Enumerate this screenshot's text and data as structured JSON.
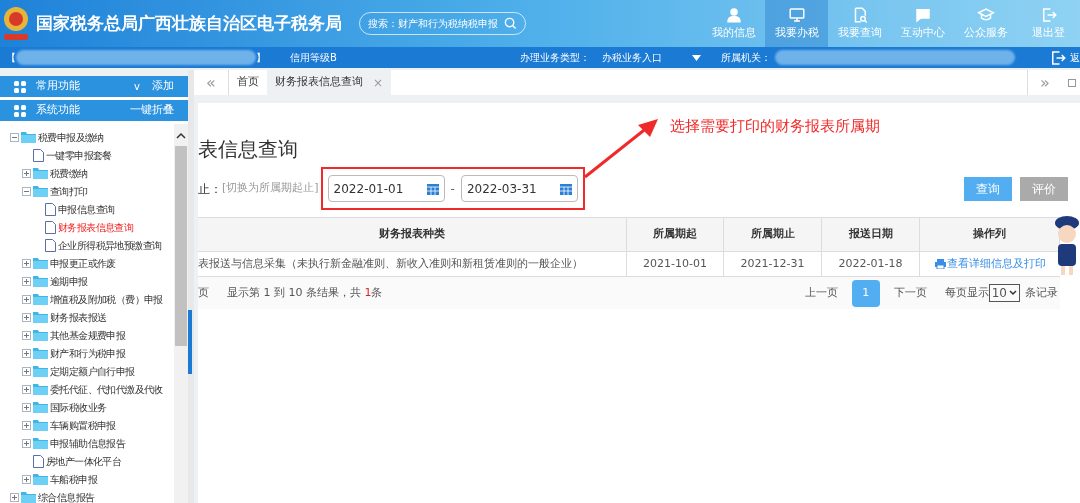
{
  "header": {
    "title": "国家税务总局广西壮族自治区电子税务局",
    "search": {
      "placeholder": "搜索：财产和行为税纳税申报"
    },
    "nav": [
      {
        "label": "我的信息",
        "selected": false
      },
      {
        "label": "我要办税",
        "selected": true
      },
      {
        "label": "我要查询",
        "selected": false
      },
      {
        "label": "互动中心",
        "selected": false
      },
      {
        "label": "公众服务",
        "selected": false
      },
      {
        "label": "退出登",
        "selected": false
      }
    ]
  },
  "info_bar": {
    "open_bracket": "【",
    "close_bracket": "】",
    "credit": "信用等级B",
    "business_label": "办理业务类型：",
    "business_value": "办税业务入口",
    "authority_label": "所属机关：",
    "back": "返"
  },
  "sidebar": {
    "sections": [
      {
        "label": "常用功能",
        "action": "添加",
        "chevron": "v"
      },
      {
        "label": "系统功能",
        "action": "一键折叠"
      }
    ],
    "tree": [
      {
        "label": "税费申报及缴纳",
        "kind": "folder",
        "expanded": true,
        "selected": false,
        "children": [
          {
            "label": "一键零申报套餐",
            "kind": "doc",
            "selected": false
          },
          {
            "label": "税费缴纳",
            "kind": "folder",
            "expanded": false,
            "selected": false
          },
          {
            "label": "查询打印",
            "kind": "folder",
            "expanded": true,
            "selected": false,
            "children": [
              {
                "label": "申报信息查询",
                "kind": "doc",
                "selected": false
              },
              {
                "label": "财务报表信息查询",
                "kind": "doc",
                "selected": true
              },
              {
                "label": "企业所得税异地预缴查询",
                "kind": "doc",
                "selected": false
              }
            ]
          },
          {
            "label": "申报更正或作废",
            "kind": "folder",
            "expanded": false,
            "selected": false
          },
          {
            "label": "逾期申报",
            "kind": "folder",
            "expanded": false,
            "selected": false
          },
          {
            "label": "增值税及附加税（费）申报",
            "kind": "folder",
            "expanded": false,
            "selected": false
          },
          {
            "label": "财务报表报送",
            "kind": "folder",
            "expanded": false,
            "selected": false
          },
          {
            "label": "其他基金规费申报",
            "kind": "folder",
            "expanded": false,
            "selected": false
          },
          {
            "label": "财产和行为税申报",
            "kind": "folder",
            "expanded": false,
            "selected": false
          },
          {
            "label": "定期定额户自行申报",
            "kind": "folder",
            "expanded": false,
            "selected": false
          },
          {
            "label": "委托代征、代扣代缴及代收",
            "kind": "folder",
            "expanded": false,
            "selected": false
          },
          {
            "label": "国际税收业务",
            "kind": "folder",
            "expanded": false,
            "selected": false
          },
          {
            "label": "车辆购置税申报",
            "kind": "folder",
            "expanded": false,
            "selected": false
          },
          {
            "label": "申报辅助信息报告",
            "kind": "folder",
            "expanded": false,
            "selected": false
          },
          {
            "label": "房地产一体化平台",
            "kind": "doc",
            "selected": false
          },
          {
            "label": "车船税申报",
            "kind": "folder",
            "expanded": false,
            "selected": false
          }
        ]
      },
      {
        "label": "综合信息报告",
        "kind": "folder",
        "expanded": false,
        "selected": false
      }
    ]
  },
  "tabs": [
    {
      "label": "首页",
      "selected": false
    },
    {
      "label": "财务报表信息查询",
      "selected": true,
      "close": "×"
    }
  ],
  "tab_nav": {
    "back": "«",
    "forward": "»"
  },
  "page": {
    "title": "表信息查询",
    "period_label": "止：",
    "switch_link": "[切换为所属期起止]",
    "start_date": "2022-01-01",
    "separator": "-",
    "end_date": "2022-03-31",
    "annotation": "选择需要打印的财务报表所属期",
    "buttons": [
      {
        "label": "查询",
        "kind": "primary"
      },
      {
        "label": "评价",
        "kind": "secondary"
      }
    ]
  },
  "table": {
    "columns": [
      "财务报表种类",
      "所属期起",
      "所属期止",
      "报送日期",
      "操作列"
    ],
    "rows": [
      {
        "cells": [
          "表报送与信息采集（未执行新金融准则、新收入准则和新租赁准则的一般企业）",
          "2021-10-01",
          "2021-12-31",
          "2022-01-18"
        ],
        "action": "查看详细信息及打印"
      }
    ]
  },
  "pagination": {
    "prefix": "页",
    "summary": "显示第 1 到 10 条结果，共 **1**条",
    "prev": "上一页",
    "pages": [
      {
        "label": "1",
        "selected": true
      }
    ],
    "next": "下一页",
    "per_page_label": "每页显示",
    "per_page": "10",
    "suffix": "条记录"
  }
}
